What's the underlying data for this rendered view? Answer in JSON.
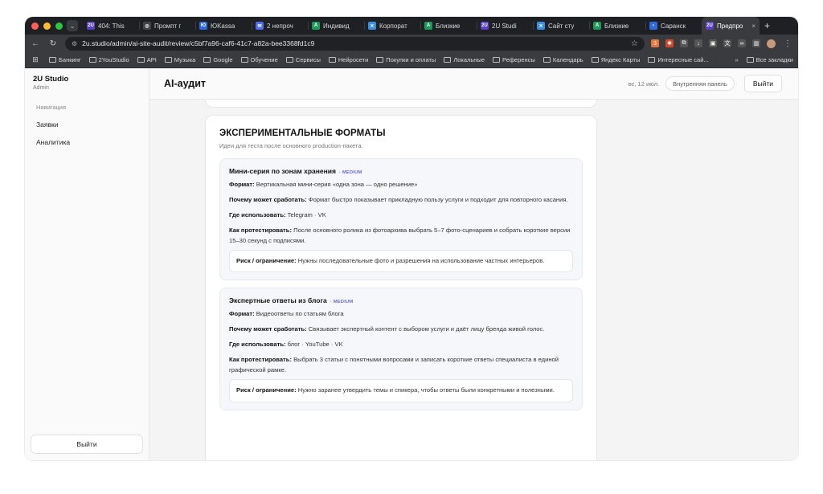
{
  "browser": {
    "traffic_colors": [
      "#ff5f57",
      "#febc2e",
      "#28c840"
    ],
    "tabs": [
      {
        "title": "404: This",
        "fav": "2U",
        "color": "#5b3fc4"
      },
      {
        "title": "Промпт г",
        "fav": "◎",
        "color": "#444"
      },
      {
        "title": "ЮKassa",
        "fav": "Ю",
        "color": "#2d6ae0"
      },
      {
        "title": "2 непроч",
        "fav": "✉",
        "color": "#4d6cf0"
      },
      {
        "title": "Индивид",
        "fav": "A",
        "color": "#1e9a5a"
      },
      {
        "title": "Корпорат",
        "fav": "✕",
        "color": "#3a8fe0"
      },
      {
        "title": "Близкие",
        "fav": "A",
        "color": "#1e9a5a"
      },
      {
        "title": "2U Studi",
        "fav": "2U",
        "color": "#5b3fc4"
      },
      {
        "title": "Сайт сту",
        "fav": "✕",
        "color": "#3a8fe0"
      },
      {
        "title": "Близкие",
        "fav": "A",
        "color": "#1e9a5a"
      },
      {
        "title": "Саранск",
        "fav": "◗",
        "color": "#2d6ae0"
      },
      {
        "title": "Предпро",
        "fav": "2U",
        "color": "#5b3fc4",
        "active": true
      }
    ],
    "url": "2u.studio/admin/ai-site-audit/review/c5bf7a96-caf6-41c7-a82a-bee3368fd1c9",
    "bookmarks": [
      "Банкинг",
      "2YouStudio",
      "API",
      "Музыка",
      "Google",
      "Обучение",
      "Сервисы",
      "Нейросети",
      "Покупки и оплаты",
      "Локальные",
      "Референсы",
      "Календарь",
      "Яндекс Карты",
      "Интересные сай..."
    ],
    "all_bookmarks": "Все закладки"
  },
  "sidebar": {
    "brand": "2U Studio",
    "role": "Admin",
    "nav_heading": "Навигация",
    "items": [
      "Заявки",
      "Аналитика"
    ],
    "logout": "Выйти"
  },
  "topbar": {
    "title": "AI-аудит",
    "date": "вс, 12 июл.",
    "internal_panel": "Внутренняя панель",
    "logout": "Выйти"
  },
  "section": {
    "title": "ЭКСПЕРИМЕНТАЛЬНЫЕ ФОРМАТЫ",
    "subtitle": "Идеи для теста после основного production-пакета.",
    "ideas": [
      {
        "title": "Мини-серия по зонам хранения",
        "badge": "· MEDIUM",
        "format_label": "Формат:",
        "format": "Вертикальная мини-серия «одна зона — одно решение»",
        "why_label": "Почему может сработать:",
        "why": "Формат быстро показывает прикладную пользу услуги и подходит для повторного касания.",
        "where_label": "Где использовать:",
        "where": "Telegram · VK",
        "test_label": "Как протестировать:",
        "test": "После основного ролика из фотоархива выбрать 5–7 фото-сценариев и собрать короткие версии 15–30 секунд с подписями.",
        "risk_label": "Риск / ограничение:",
        "risk": "Нужны последовательные фото и разрешения на использование частных интерьеров."
      },
      {
        "title": "Экспертные ответы из блога",
        "badge": "· MEDIUM",
        "format_label": "Формат:",
        "format": "Видеоответы по статьям блога",
        "why_label": "Почему может сработать:",
        "why": "Связывает экспертный контент с выбором услуги и даёт лицу бренда живой голос.",
        "where_label": "Где использовать:",
        "where": "блог · YouTube · VK",
        "test_label": "Как протестировать:",
        "test": "Выбрать 3 статьи с понятными вопросами и записать короткие ответы специалиста в единой графической рамке.",
        "risk_label": "Риск / ограничение:",
        "risk": "Нужно заранее утвердить темы и спикера, чтобы ответы были конкретными и полезными."
      }
    ]
  }
}
